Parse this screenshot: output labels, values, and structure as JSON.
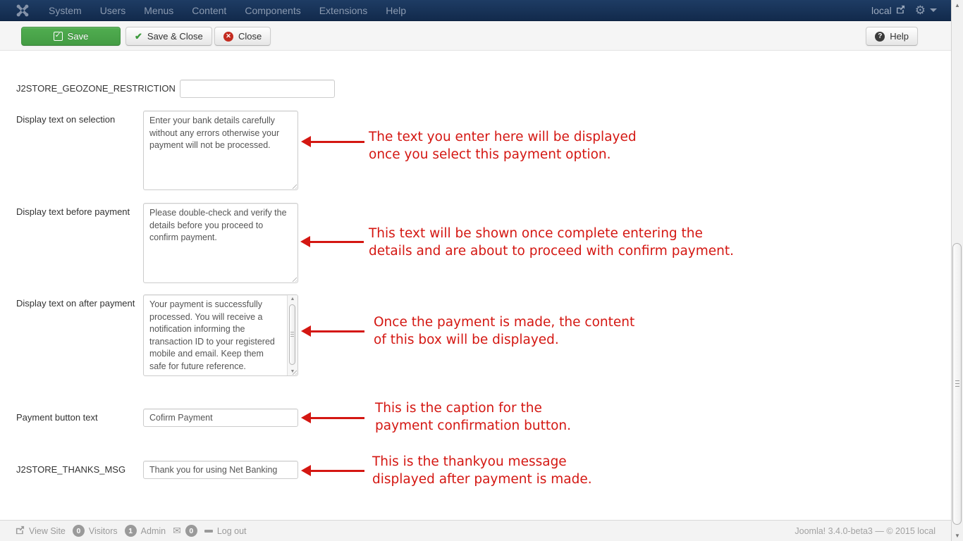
{
  "navbar": {
    "menus": [
      "System",
      "Users",
      "Menus",
      "Content",
      "Components",
      "Extensions",
      "Help"
    ],
    "site_link": "local"
  },
  "toolbar": {
    "save": "Save",
    "save_and_close": "Save & Close",
    "close": "Close",
    "help": "Help"
  },
  "form": {
    "rows": [
      {
        "label": "J2STORE_GEOZONE_RESTRICTION",
        "type": "input",
        "value": ""
      },
      {
        "label": "Display text on selection",
        "type": "textarea",
        "value": "Enter your bank details carefully without any errors otherwise your payment will not be processed."
      },
      {
        "label": "Display text before payment",
        "type": "textarea",
        "value": "Please double-check and verify the details before you proceed to confirm payment."
      },
      {
        "label": "Display text on after payment",
        "type": "textarea",
        "value": "Your payment is successfully processed. You will receive a notification informing the transaction ID to your registered mobile and email. Keep them safe for future reference."
      },
      {
        "label": "Payment button text",
        "type": "input",
        "value": "Cofirm Payment"
      },
      {
        "label": "J2STORE_THANKS_MSG",
        "type": "input",
        "value": "Thank you for using Net Banking"
      }
    ]
  },
  "annotations": [
    {
      "line1": "The text you enter here will be displayed",
      "line2": "once you select this payment option."
    },
    {
      "line1": "This text will be shown once complete entering the",
      "line2": "details and are about to proceed with confirm payment."
    },
    {
      "line1": "Once the payment is made, the content",
      "line2": "of this box will be displayed."
    },
    {
      "line1": "This is the caption for the",
      "line2": "payment confirmation button."
    },
    {
      "line1": "This is the thankyou message",
      "line2": "displayed after payment is made."
    }
  ],
  "footer": {
    "view_site": "View Site",
    "visitors_count": "0",
    "visitors_label": "Visitors",
    "admin_count": "1",
    "admin_label": "Admin",
    "messages_count": "0",
    "log_out": "Log out",
    "version": "Joomla! 3.4.0-beta3 — © 2015 local"
  },
  "colors": {
    "navbar_bg": "#1e3c64",
    "save_green": "#46a546",
    "annotation_red": "#d41712"
  }
}
